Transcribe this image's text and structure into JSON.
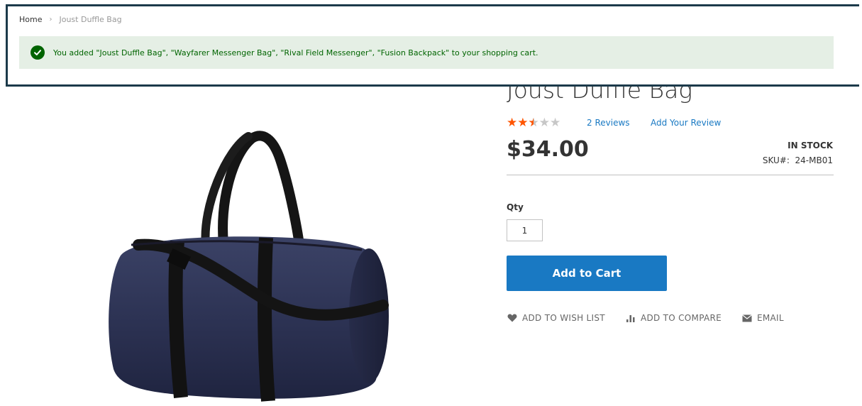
{
  "breadcrumb": {
    "home": "Home",
    "separator": "›",
    "current": "Joust Duffle Bag"
  },
  "message": {
    "text": "You added \"Joust Duffle Bag\", \"Wayfarer Messenger Bag\", \"Rival Field Messenger\", \"Fusion Backpack\" to your shopping cart.",
    "icon": "check-circle-icon",
    "color": "#006400",
    "background": "#e5efe5"
  },
  "product": {
    "title": "Joust Duffle Bag",
    "rating_stars_out_of_5": 2.5,
    "reviews_link": "2 Reviews",
    "add_review_link": "Add Your Review",
    "price": "$34.00",
    "stock": "IN STOCK",
    "sku_label": "SKU#:",
    "sku": "24-MB01",
    "qty_label": "Qty",
    "qty_value": "1",
    "add_to_cart_label": "Add to Cart",
    "image_icon": "duffle-bag-image"
  },
  "actions": {
    "wishlist": "ADD TO WISH LIST",
    "compare": "ADD TO COMPARE",
    "email": "EMAIL"
  },
  "colors": {
    "accent": "#1979c3",
    "star_on": "#ff5501",
    "star_off": "#c7c7c7",
    "highlight_border": "#1c3a4a"
  }
}
